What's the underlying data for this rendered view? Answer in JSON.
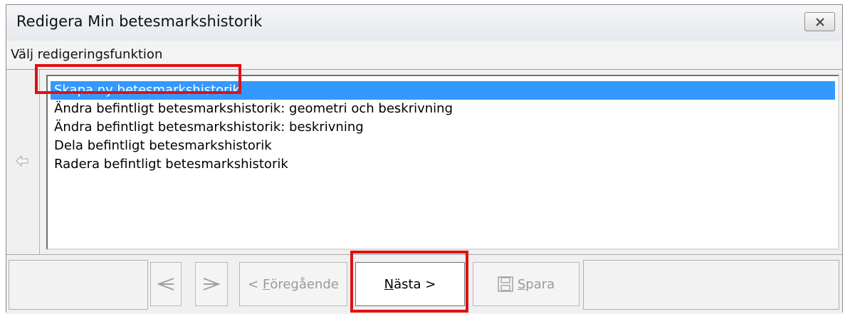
{
  "window": {
    "title": "Redigera Min betesmarkshistorik",
    "close_icon": "close-icon"
  },
  "subheader": {
    "label": "Välj redigeringsfunktion"
  },
  "list": {
    "items": [
      {
        "label": "Skapa ny betesmarkshistorik",
        "selected": true
      },
      {
        "label": "Ändra befintligt betesmarkshistorik: geometri och beskrivning"
      },
      {
        "label": "Ändra befintligt betesmarkshistorik: beskrivning"
      },
      {
        "label": "Dela befintligt betesmarkshistorik"
      },
      {
        "label": "Radera befintligt betesmarkshistorik"
      }
    ]
  },
  "toolbar": {
    "prev_prefix": "< ",
    "prev_mnemonic": "F",
    "prev_rest": "öregående",
    "next_mnemonic": "N",
    "next_rest": "ästa >",
    "save_mnemonic": "S",
    "save_rest": "para"
  },
  "colors": {
    "selection": "#3399ff",
    "highlight": "#e01010"
  }
}
